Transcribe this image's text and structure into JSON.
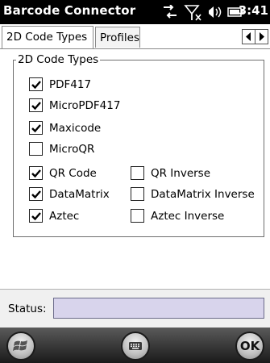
{
  "titlebar": {
    "title": "Barcode Connector",
    "time": "3:41"
  },
  "tabs": [
    {
      "label": "2D Code Types"
    },
    {
      "label": "Profiles"
    }
  ],
  "group": {
    "legend": "2D Code Types",
    "options": [
      {
        "label": "PDF417",
        "checked": true
      },
      {
        "label": "MicroPDF417",
        "checked": true
      },
      {
        "label": "Maxicode",
        "checked": true
      },
      {
        "label": "MicroQR",
        "checked": false
      },
      {
        "label": "QR Code",
        "checked": true
      },
      {
        "label": "QR Inverse",
        "checked": false
      },
      {
        "label": "DataMatrix",
        "checked": true
      },
      {
        "label": "DataMatrix Inverse",
        "checked": false
      },
      {
        "label": "Aztec",
        "checked": true
      },
      {
        "label": "Aztec Inverse",
        "checked": false
      }
    ]
  },
  "status": {
    "label": "Status:",
    "value": ""
  },
  "softkeys": {
    "ok_label": "OK"
  }
}
